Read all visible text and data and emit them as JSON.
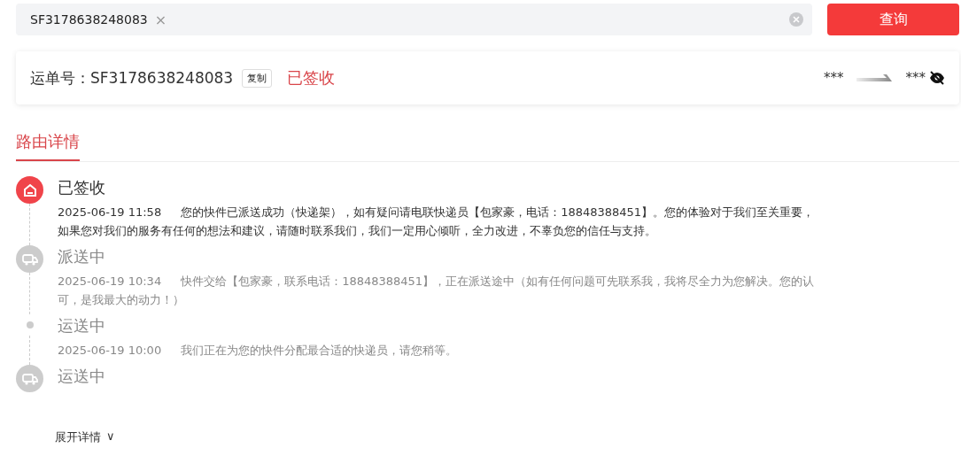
{
  "search": {
    "value": "SF3178638248083",
    "tag_close": "×",
    "button": "查询"
  },
  "waybill": {
    "label": "运单号：",
    "number": "SF3178638248083",
    "copy": "复制",
    "status": "已签收",
    "from": "***",
    "to": "***"
  },
  "tabs": [
    {
      "label": "路由详情",
      "selected": true
    }
  ],
  "timeline": [
    {
      "kind": "signed",
      "active": true,
      "title": "已签收",
      "time": "2025-06-19 11:58",
      "text": "您的快件已派送成功（快递架），如有疑问请电联快递员【包家豪，电话：18848388451】。您的体验对于我们至关重要，如果您对我们的服务有任何的想法和建议，请随时联系我们，我们一定用心倾听，全力改进，不辜负您的信任与支持。"
    },
    {
      "kind": "truck",
      "active": false,
      "title": "派送中",
      "time": "2025-06-19 10:34",
      "text": "快件交给【包家豪，联系电话：18848388451】，正在派送途中（如有任何问题可先联系我，我将尽全力为您解决。您的认可，是我最大的动力！）"
    },
    {
      "kind": "dot",
      "active": false,
      "title": "运送中",
      "time": "2025-06-19 10:00",
      "text": "我们正在为您的快件分配最合适的快递员，请您稍等。"
    },
    {
      "kind": "truck",
      "active": false,
      "title": "运送中"
    }
  ],
  "expand": {
    "label": "展开详情",
    "caret": "∨"
  }
}
